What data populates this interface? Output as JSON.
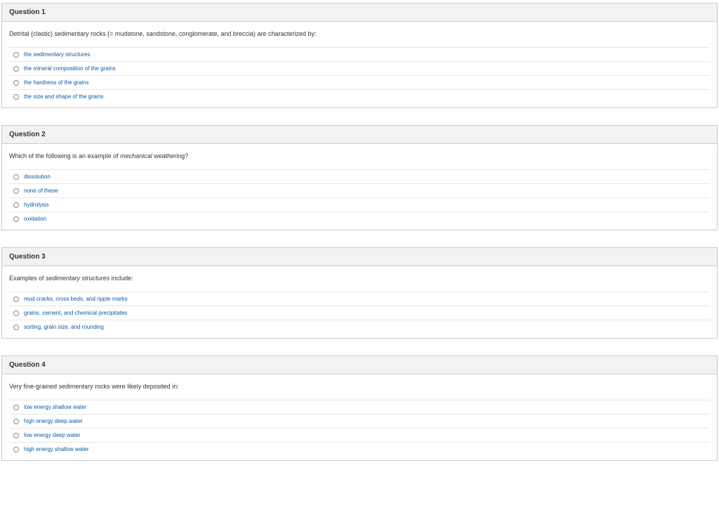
{
  "questions": [
    {
      "header": "Question 1",
      "prompt_html": "Detrital (clastic) sedimentary rocks (= mudstone, sandstone, conglomerate, and breccia) are characterized by:",
      "options": [
        "the sedimentary structures",
        "the mineral composition of the grains",
        "the hardness of the grains",
        "the size and shape of the grains"
      ]
    },
    {
      "header": "Question 2",
      "prompt_html": "Which of the following is an example of <em>mechanical</em> weathering?",
      "options": [
        "dissolution",
        "none of these",
        "hydrolysis",
        "oxidation"
      ]
    },
    {
      "header": "Question 3",
      "prompt_html": "Examples of <em>sedimentary structures</em> include:",
      "options": [
        "mud cracks, cross beds, and ripple marks",
        "grains, cement, and chemical precipitates",
        "sorting, grain size, and rounding"
      ]
    },
    {
      "header": "Question 4",
      "prompt_html": "Very fine-grained sedimentary rocks were likely deposited in:",
      "options": [
        "low energy shallow water",
        "high energy deep water",
        "low energy deep water",
        "high energy shallow water"
      ]
    }
  ]
}
